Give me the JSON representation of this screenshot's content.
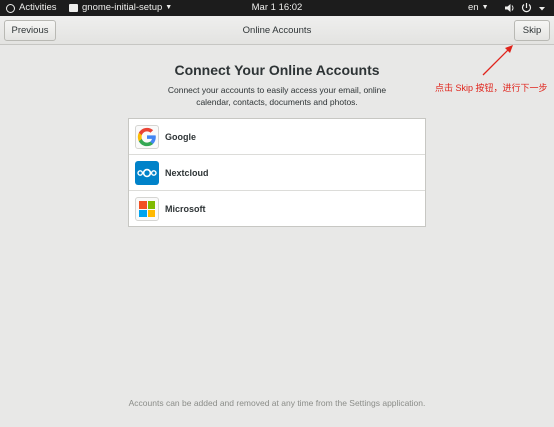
{
  "topbar": {
    "activities": "Activities",
    "app_name": "gnome-initial-setup",
    "clock": "Mar 1  16:02",
    "language": "en"
  },
  "headerbar": {
    "previous_label": "Previous",
    "title": "Online Accounts",
    "skip_label": "Skip"
  },
  "main": {
    "heading": "Connect Your Online Accounts",
    "description": "Connect your accounts to easily access your email, online calendar, contacts, documents and photos.",
    "accounts": [
      {
        "label": "Google",
        "icon": "google-icon"
      },
      {
        "label": "Nextcloud",
        "icon": "nextcloud-icon"
      },
      {
        "label": "Microsoft",
        "icon": "microsoft-icon"
      }
    ],
    "footer": "Accounts can be added and removed at any time from the Settings application."
  },
  "annotation": {
    "text": "点击 Skip 按钮，进行下一步",
    "color": "#e0231b"
  },
  "colors": {
    "topbar": "#1c1c1c",
    "background": "#e8e8e7",
    "nextcloud_blue": "#0082c9"
  }
}
